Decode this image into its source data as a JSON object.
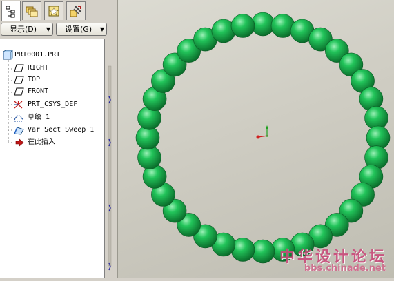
{
  "tabs": [
    {
      "icon": "model-tree-icon",
      "active": true
    },
    {
      "icon": "folder-browser-icon",
      "active": false
    },
    {
      "icon": "favorites-icon",
      "active": false
    },
    {
      "icon": "connections-icon",
      "active": false
    }
  ],
  "toolbar": {
    "show_label": "显示(D)",
    "settings_label": "设置(G)"
  },
  "tree": {
    "root": {
      "label": "PRT0001.PRT",
      "icon": "part-icon"
    },
    "items": [
      {
        "label": "RIGHT",
        "icon": "datum-plane-icon"
      },
      {
        "label": "TOP",
        "icon": "datum-plane-icon"
      },
      {
        "label": "FRONT",
        "icon": "datum-plane-icon"
      },
      {
        "label": "PRT_CSYS_DEF",
        "icon": "coordinate-system-icon"
      },
      {
        "label": "草绘 1",
        "icon": "sketch-icon"
      },
      {
        "label": "Var Sect Sweep 1",
        "icon": "var-sect-sweep-icon"
      },
      {
        "label": "在此插入",
        "icon": "insert-here-arrow-icon"
      }
    ]
  },
  "viewport": {
    "bead_count": 36,
    "bead_color": "#22c45a",
    "bead_highlight": "#9af0b6",
    "bead_shadow": "#0a6a2a",
    "csys_colors": {
      "x": "#d02020",
      "y": "#20a020",
      "origin": "#d02020"
    }
  },
  "watermark": {
    "chinese": "中华设计论坛",
    "url": "bbs.chinade.net"
  },
  "colors": {
    "panel_bg": "#d4d0c8",
    "tree_bg": "#ffffff",
    "splitter_arrow": "#2a2aa0"
  }
}
